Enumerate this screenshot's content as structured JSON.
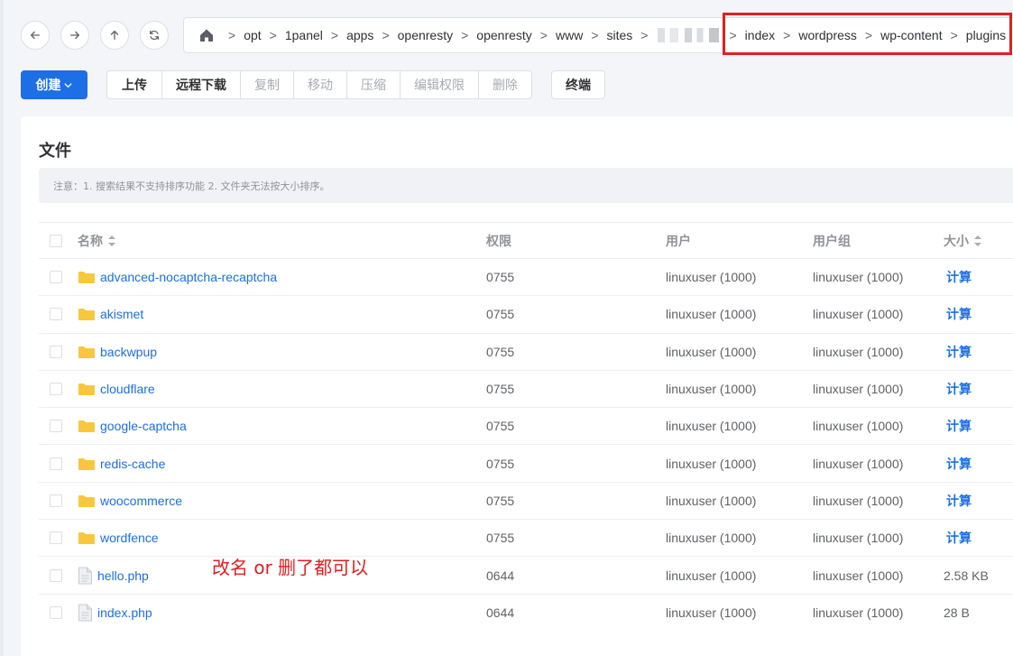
{
  "nav": {
    "back_icon": "arrow-left-icon",
    "forward_icon": "arrow-right-icon",
    "up_icon": "arrow-up-icon",
    "refresh_icon": "refresh-icon"
  },
  "path": {
    "home_icon": "home-icon",
    "separator": ">",
    "segments": [
      "opt",
      "1panel",
      "apps",
      "openresty",
      "openresty",
      "www",
      "sites"
    ],
    "highlighted_segments": [
      "index",
      "wordpress",
      "wp-content",
      "plugins"
    ]
  },
  "toolbar": {
    "create": "创建",
    "group": [
      "上传",
      "远程下载",
      "复制",
      "移动",
      "压缩",
      "编辑权限",
      "删除"
    ],
    "terminal": "终端"
  },
  "card": {
    "title": "文件",
    "notice": "注意：1. 搜索结果不支持排序功能 2. 文件夹无法按大小排序。"
  },
  "table": {
    "headers": {
      "name": "名称",
      "perm": "权限",
      "user": "用户",
      "group": "用户组",
      "size": "大小"
    },
    "rows": [
      {
        "name": "advanced-nocaptcha-recaptcha",
        "type": "folder",
        "perm": "0755",
        "user": "linuxuser (1000)",
        "group": "linuxuser (1000)",
        "size": "计算"
      },
      {
        "name": "akismet",
        "type": "folder",
        "perm": "0755",
        "user": "linuxuser (1000)",
        "group": "linuxuser (1000)",
        "size": "计算"
      },
      {
        "name": "backwpup",
        "type": "folder",
        "perm": "0755",
        "user": "linuxuser (1000)",
        "group": "linuxuser (1000)",
        "size": "计算"
      },
      {
        "name": "cloudflare",
        "type": "folder",
        "perm": "0755",
        "user": "linuxuser (1000)",
        "group": "linuxuser (1000)",
        "size": "计算"
      },
      {
        "name": "google-captcha",
        "type": "folder",
        "perm": "0755",
        "user": "linuxuser (1000)",
        "group": "linuxuser (1000)",
        "size": "计算"
      },
      {
        "name": "redis-cache",
        "type": "folder",
        "perm": "0755",
        "user": "linuxuser (1000)",
        "group": "linuxuser (1000)",
        "size": "计算"
      },
      {
        "name": "woocommerce",
        "type": "folder",
        "perm": "0755",
        "user": "linuxuser (1000)",
        "group": "linuxuser (1000)",
        "size": "计算"
      },
      {
        "name": "wordfence",
        "type": "folder",
        "perm": "0755",
        "user": "linuxuser (1000)",
        "group": "linuxuser (1000)",
        "size": "计算"
      },
      {
        "name": "hello.php",
        "type": "file",
        "perm": "0644",
        "user": "linuxuser (1000)",
        "group": "linuxuser (1000)",
        "size": "2.58 KB"
      },
      {
        "name": "index.php",
        "type": "file",
        "perm": "0644",
        "user": "linuxuser (1000)",
        "group": "linuxuser (1000)",
        "size": "28 B"
      }
    ]
  },
  "annotation": "改名 or 删了都可以",
  "colors": {
    "primary": "#1d6fe5",
    "highlight": "#e02020",
    "folder": "#f9c73d"
  }
}
